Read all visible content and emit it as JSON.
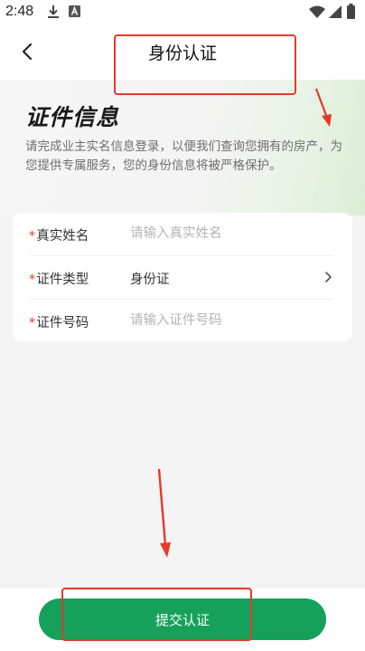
{
  "status_bar": {
    "time": "2:48",
    "icons": [
      "download-icon",
      "a-badge-icon",
      "wifi-icon",
      "signal-icon",
      "battery-icon"
    ]
  },
  "nav": {
    "title": "身份认证",
    "back_icon": "chevron-left-icon"
  },
  "hero": {
    "title": "证件信息",
    "description": "请完成业主实名信息登录，以便我们查询您拥有的房产，为您提供专属服务，您的身份信息将被严格保护。"
  },
  "form": {
    "required_mark": "*",
    "fields": [
      {
        "label": "真实姓名",
        "placeholder": "请输入真实姓名",
        "value": ""
      },
      {
        "label": "证件类型",
        "value": "身份证",
        "icon": "chevron-right-icon"
      },
      {
        "label": "证件号码",
        "placeholder": "请输入证件号码",
        "value": ""
      }
    ]
  },
  "footer": {
    "submit_label": "提交认证"
  },
  "colors": {
    "accent": "#15a15a",
    "required": "#e0372c",
    "annotation": "#e53a2b"
  }
}
